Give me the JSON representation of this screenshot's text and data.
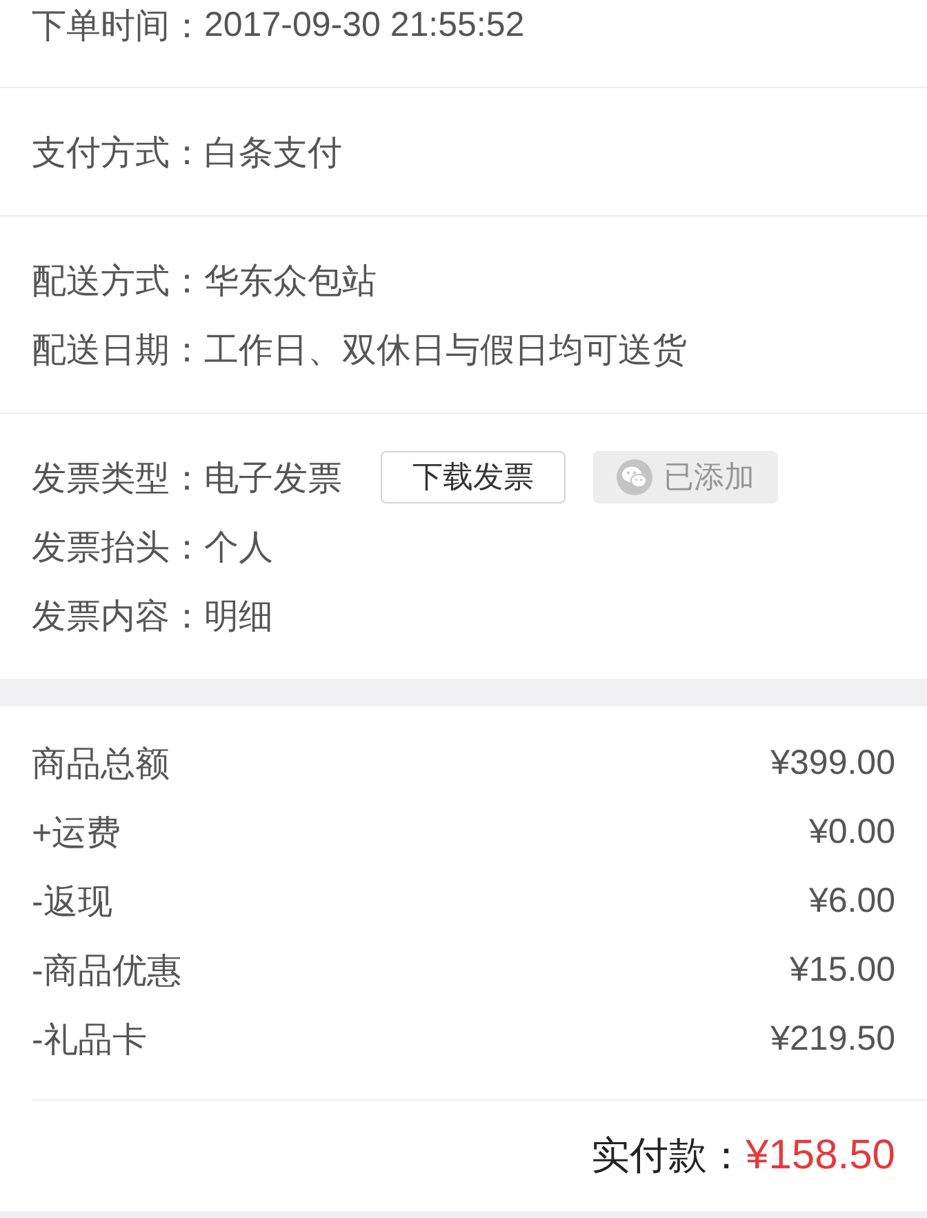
{
  "info_sections": [
    {
      "rows": [
        {
          "label": "下单时间：",
          "value": "2017-09-30 21:55:52"
        }
      ]
    },
    {
      "rows": [
        {
          "label": "支付方式：",
          "value": "白条支付"
        }
      ]
    },
    {
      "rows": [
        {
          "label": "配送方式：",
          "value": "华东众包站"
        },
        {
          "label": "配送日期：",
          "value": "工作日、双休日与假日均可送货"
        }
      ]
    },
    {
      "rows": [
        {
          "label": "发票类型：",
          "value": "电子发票",
          "buttons": [
            {
              "label": "下载发票",
              "kind": "plain",
              "disabled": false
            },
            {
              "label": "已添加",
              "kind": "icon",
              "disabled": true
            }
          ]
        },
        {
          "label": "发票抬头：",
          "value": "个人"
        },
        {
          "label": "发票内容：",
          "value": "明细"
        }
      ]
    }
  ],
  "amounts": {
    "rows": [
      {
        "label": "商品总额",
        "value": "¥399.00"
      },
      {
        "label": "+运费",
        "value": "¥0.00"
      },
      {
        "label": "-返现",
        "value": "¥6.00"
      },
      {
        "label": "-商品优惠",
        "value": "¥15.00"
      },
      {
        "label": "-礼品卡",
        "value": "¥219.50"
      }
    ],
    "total": {
      "label": "实付款：",
      "value": "¥158.50"
    }
  }
}
